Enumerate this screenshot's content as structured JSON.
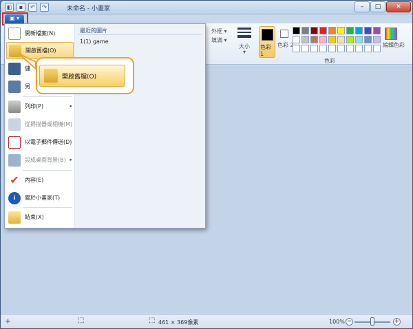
{
  "window": {
    "title": "未命名 - 小畫家",
    "min": "–",
    "max": "□",
    "close": "✕"
  },
  "app_menu_button": {
    "label": "▣ ▾"
  },
  "ribbon": {
    "outline_label": "外框 ▾",
    "fill_label": "填滿 ▾",
    "size_label": "大小",
    "size_arrow": "▾",
    "color1_label": "色彩 1",
    "color2_label": "色彩 2",
    "edit_colors_label": "編輯色彩",
    "colors_group_label": "色彩",
    "palette": [
      "#000000",
      "#7f7f7f",
      "#880015",
      "#ed1c24",
      "#ff7f27",
      "#fff200",
      "#22b14c",
      "#00a2e8",
      "#3f48cc",
      "#a349a4",
      "#ffffff",
      "#c3c3c3",
      "#b97a57",
      "#ffaec9",
      "#ffc90e",
      "#efe4b0",
      "#b5e61d",
      "#99d9ea",
      "#7092be",
      "#c8bfe7",
      "#ffffff",
      "#ffffff",
      "#ffffff",
      "#ffffff",
      "#ffffff",
      "#ffffff",
      "#ffffff",
      "#ffffff",
      "#ffffff",
      "#ffffff"
    ]
  },
  "menu": {
    "items": [
      {
        "label": "開新檔案(N)"
      },
      {
        "label": "開啟舊檔(O)"
      },
      {
        "label": "儲"
      },
      {
        "label": "另"
      },
      {
        "label": "列印(P)"
      },
      {
        "label": "從掃描器或相機(M)"
      },
      {
        "label": "以電子郵件傳送(D)"
      },
      {
        "label": "設成桌面背景(B)"
      },
      {
        "label": "內容(E)"
      },
      {
        "label": "關於小畫家(T)"
      },
      {
        "label": "結束(X)"
      }
    ],
    "submenu_arrow": "▸",
    "recent_header": "最近的圖片",
    "recent_items": [
      {
        "label": "1(1)  game"
      }
    ]
  },
  "callout": {
    "label": "開啟舊檔(O)"
  },
  "status": {
    "add": "+",
    "dimensions": "461 × 369像素",
    "zoom": "100%",
    "zoom_out": "−",
    "zoom_in": "+",
    "zoom_level": 0.5
  }
}
